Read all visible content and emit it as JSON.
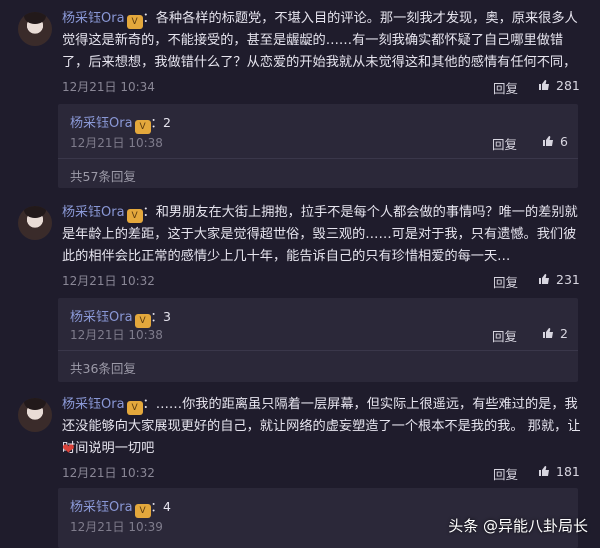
{
  "comments": [
    {
      "username": "杨采钰Ora",
      "text": "：各种各样的标题党，不堪入目的评论。那一刻我才发现，奥，原来很多人觉得这是新奇的，不能接受的，甚至是龌龊的……有一刻我确实都怀疑了自己哪里做错了，后来想想，我做错什么了？从恋爱的开始我就从未觉得这和其他的感情有任何不同，",
      "time": "12月21日 10:34",
      "reply_label": "回复",
      "likes": "281",
      "sub": {
        "username": "杨采钰Ora",
        "count_text": "：2",
        "time": "12月21日 10:38",
        "reply_label": "回复",
        "likes": "6",
        "more": "共57条回复"
      }
    },
    {
      "username": "杨采钰Ora",
      "text": "：和男朋友在大街上拥抱，拉手不是每个人都会做的事情吗？唯一的差别就是年龄上的差距，这于大家是觉得超世俗，毁三观的……可是对于我，只有遗憾。我们彼此的相伴会比正常的感情少上几十年，能告诉自己的只有珍惜相爱的每一天…",
      "time": "12月21日 10:32",
      "reply_label": "回复",
      "likes": "231",
      "sub": {
        "username": "杨采钰Ora",
        "count_text": "：3",
        "time": "12月21日 10:38",
        "reply_label": "回复",
        "likes": "2",
        "more": "共36条回复"
      }
    },
    {
      "username": "杨采钰Ora",
      "text": "：……你我的距离虽只隔着一层屏幕，但实际上很遥远，有些难过的是，我还没能够向大家展现更好的自己，就让网络的虚妄塑造了一个根本不是我的我。 那就，让时间说明一切吧",
      "emoji": "❤",
      "time": "12月21日 10:32",
      "reply_label": "回复",
      "likes": "181",
      "sub": {
        "username": "杨采钰Ora",
        "count_text": "：4",
        "time": "12月21日 10:39"
      }
    }
  ],
  "watermark": "头条 @异能八卦局长",
  "colors": {
    "background": "#1f1c2c",
    "username": "#8a98d6",
    "badge": "#e4a83c",
    "heart": "#d9423a"
  }
}
